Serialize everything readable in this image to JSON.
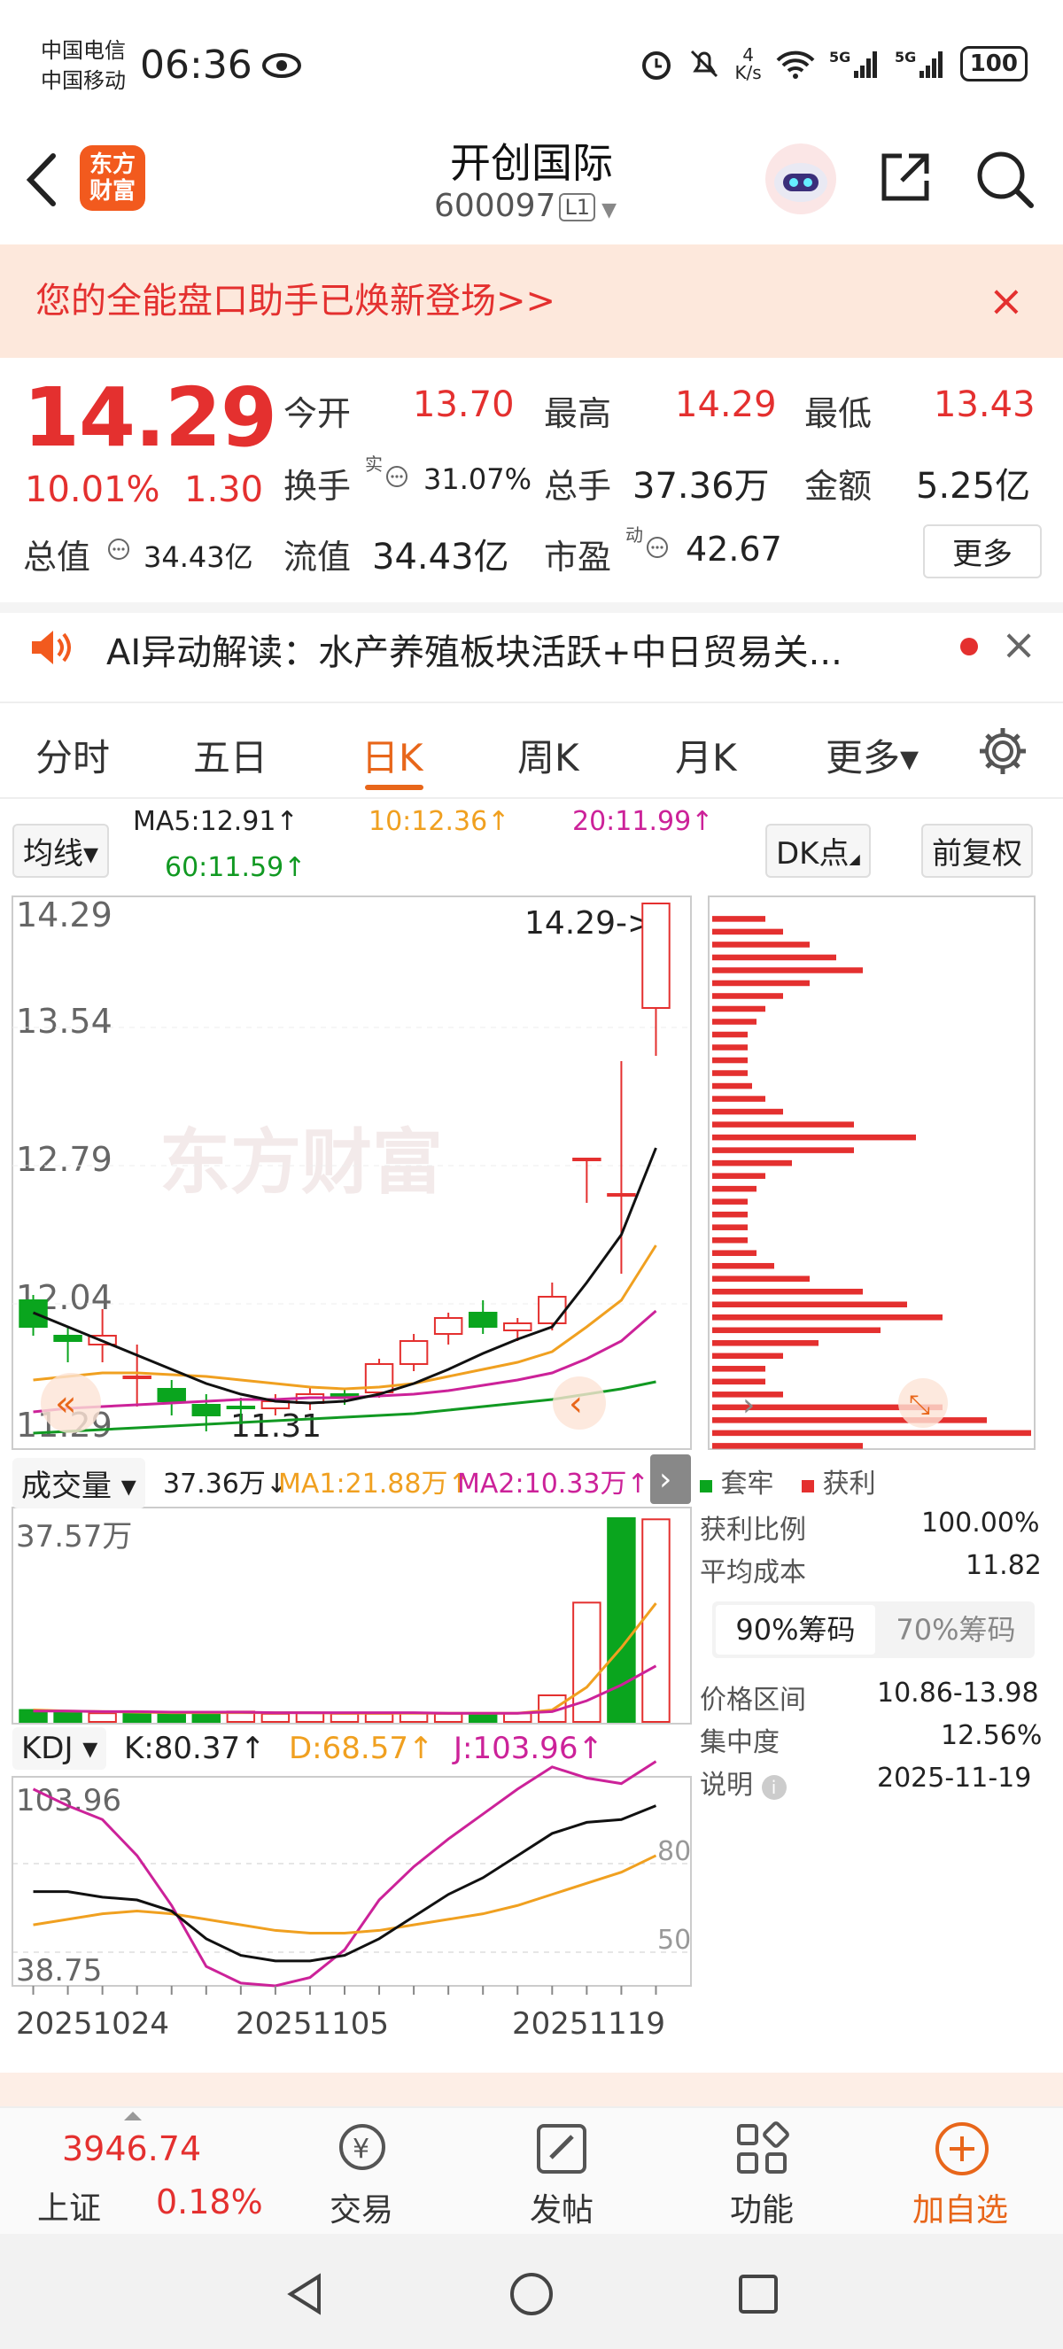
{
  "status": {
    "carrier1": "中国电信",
    "carrier2": "中国移动",
    "time": "06:36",
    "speed_top": "4",
    "speed_bot": "K/s",
    "battery": "100"
  },
  "header": {
    "title": "开创国际",
    "code": "600097",
    "market_badge": "L1",
    "logo_text_1": "东方",
    "logo_text_2": "财富"
  },
  "banner": {
    "text": "您的全能盘口助手已焕新登场>>",
    "close": "×"
  },
  "quote": {
    "price": "14.29",
    "change_pct": "10.01%",
    "change": "1.30",
    "open_label": "今开",
    "open": "13.70",
    "high_label": "最高",
    "high": "14.29",
    "low_label": "最低",
    "low": "13.43",
    "turnover_label": "换手",
    "turnover_sup": "实",
    "turnover": "31.07%",
    "volume_label": "总手",
    "volume": "37.36万",
    "amount_label": "金额",
    "amount": "5.25亿",
    "mktcap_label": "总值",
    "mktcap": "34.43亿",
    "float_label": "流值",
    "float": "34.43亿",
    "pe_label": "市盈",
    "pe_sup": "动",
    "pe": "42.67",
    "more": "更多"
  },
  "ai": {
    "text": "AI异动解读：水产养殖板块活跃+中日贸易关...",
    "close": "×"
  },
  "tabs": [
    "分时",
    "五日",
    "日K",
    "周K",
    "月K",
    "更多▾"
  ],
  "active_tab": 2,
  "ma": {
    "selector": "均线▾",
    "ma5": "MA5:12.91↑",
    "ma10": "10:12.36↑",
    "ma20": "20:11.99↑",
    "ma60": "60:11.59↑",
    "dk": "DK点",
    "adjust": "前复权"
  },
  "price_axis": {
    "p1": "14.29",
    "p2": "13.54",
    "p3": "12.79",
    "p4": "12.04",
    "p5": "11.29",
    "last": "14.29->",
    "low": "11.31",
    "watermark": "东方财富"
  },
  "volume": {
    "selector": "成交量 ▾",
    "v": "37.36万↓",
    "ma1": "MA1:21.88万↑",
    "ma2": "MA2:10.33万↑",
    "max": "37.57万"
  },
  "kdj": {
    "selector": "KDJ ▾",
    "k": "K:80.37↑",
    "d": "D:68.57↑",
    "j": "J:103.96↑",
    "max": "103.96",
    "min": "38.75",
    "l80": "80",
    "l50": "50"
  },
  "dates": {
    "d1": "20251024",
    "d2": "20251105",
    "d3": "20251119"
  },
  "chip": {
    "legend_trap": "套牢",
    "legend_profit": "获利",
    "profit_ratio_label": "获利比例",
    "profit_ratio": "100.00%",
    "avg_cost_label": "平均成本",
    "avg_cost": "11.82",
    "tab90": "90%筹码",
    "tab70": "70%筹码",
    "range_label": "价格区间",
    "range": "10.86-13.98",
    "conc_label": "集中度",
    "conc": "12.56%",
    "note_label": "说明",
    "note_date": "2025-11-19"
  },
  "bottom": {
    "index_val": "3946.74",
    "index_name": "上证",
    "index_pct": "0.18%",
    "trade": "交易",
    "post": "发帖",
    "func": "功能",
    "add": "加自选"
  },
  "colors": {
    "red": "#e4302f",
    "green": "#0aa51e",
    "orange": "#e8661a",
    "ma10": "#f0a020",
    "ma20": "#cc2299",
    "ma60": "#119922"
  },
  "candles": [
    {
      "o": 12.05,
      "c": 11.9,
      "h": 12.08,
      "l": 11.85
    },
    {
      "o": 11.85,
      "c": 11.82,
      "h": 11.9,
      "l": 11.7
    },
    {
      "o": 11.8,
      "c": 11.85,
      "h": 12.0,
      "l": 11.7
    },
    {
      "o": 11.62,
      "c": 11.62,
      "h": 11.8,
      "l": 11.45
    },
    {
      "o": 11.55,
      "c": 11.48,
      "h": 11.6,
      "l": 11.4
    },
    {
      "o": 11.46,
      "c": 11.4,
      "h": 11.52,
      "l": 11.31
    },
    {
      "o": 11.45,
      "c": 11.44,
      "h": 11.5,
      "l": 11.35
    },
    {
      "o": 11.44,
      "c": 11.48,
      "h": 11.52,
      "l": 11.4
    },
    {
      "o": 11.47,
      "c": 11.52,
      "h": 11.56,
      "l": 11.43
    },
    {
      "o": 11.52,
      "c": 11.5,
      "h": 11.55,
      "l": 11.46
    },
    {
      "o": 11.53,
      "c": 11.69,
      "h": 11.72,
      "l": 11.5
    },
    {
      "o": 11.69,
      "c": 11.82,
      "h": 11.86,
      "l": 11.65
    },
    {
      "o": 11.86,
      "c": 11.95,
      "h": 11.98,
      "l": 11.8
    },
    {
      "o": 11.98,
      "c": 11.9,
      "h": 12.05,
      "l": 11.86
    },
    {
      "o": 11.88,
      "c": 11.92,
      "h": 11.95,
      "l": 11.82
    },
    {
      "o": 11.92,
      "c": 12.07,
      "h": 12.15,
      "l": 11.88
    },
    {
      "o": 12.85,
      "c": 12.85,
      "h": 12.85,
      "l": 12.6
    },
    {
      "o": 12.65,
      "c": 12.65,
      "h": 13.4,
      "l": 12.2
    },
    {
      "o": 13.7,
      "c": 14.29,
      "h": 14.29,
      "l": 13.43
    }
  ],
  "ma5_line": [
    11.98,
    11.9,
    11.82,
    11.74,
    11.66,
    11.58,
    11.52,
    11.48,
    11.47,
    11.48,
    11.52,
    11.58,
    11.66,
    11.75,
    11.83,
    11.9,
    12.15,
    12.42,
    12.91
  ],
  "ma10_line": [
    11.6,
    11.62,
    11.64,
    11.64,
    11.63,
    11.62,
    11.6,
    11.58,
    11.56,
    11.55,
    11.56,
    11.58,
    11.62,
    11.66,
    11.7,
    11.76,
    11.9,
    12.05,
    12.36
  ],
  "ma20_line": [
    11.42,
    11.44,
    11.45,
    11.46,
    11.47,
    11.48,
    11.49,
    11.49,
    11.5,
    11.5,
    11.51,
    11.52,
    11.54,
    11.57,
    11.6,
    11.64,
    11.72,
    11.82,
    11.99
  ],
  "ma60_line": [
    11.3,
    11.31,
    11.32,
    11.33,
    11.34,
    11.35,
    11.36,
    11.37,
    11.38,
    11.39,
    11.4,
    11.41,
    11.43,
    11.45,
    11.47,
    11.49,
    11.52,
    11.55,
    11.59
  ],
  "vols": [
    2.2,
    1.7,
    1.6,
    1.9,
    1.6,
    1.7,
    1.9,
    1.5,
    1.6,
    1.5,
    1.5,
    1.6,
    1.5,
    1.6,
    1.6,
    4.9,
    22.0,
    37.57,
    37.36
  ],
  "vols_up": [
    false,
    false,
    true,
    false,
    false,
    false,
    true,
    true,
    true,
    true,
    true,
    true,
    true,
    false,
    true,
    true,
    true,
    false,
    true
  ],
  "k_line": [
    67,
    67,
    65,
    64,
    60,
    50,
    44,
    42,
    42,
    44,
    50,
    58,
    66,
    72,
    80,
    88,
    92,
    93,
    98
  ],
  "d_line": [
    55,
    57,
    59,
    60,
    59,
    57,
    55,
    53,
    52,
    52,
    53,
    55,
    57,
    59,
    62,
    66,
    70,
    74,
    80
  ],
  "j_line": [
    104,
    98,
    93,
    80,
    62,
    40,
    34,
    33,
    36,
    46,
    64,
    76,
    86,
    95,
    104,
    112,
    108,
    106,
    114
  ]
}
